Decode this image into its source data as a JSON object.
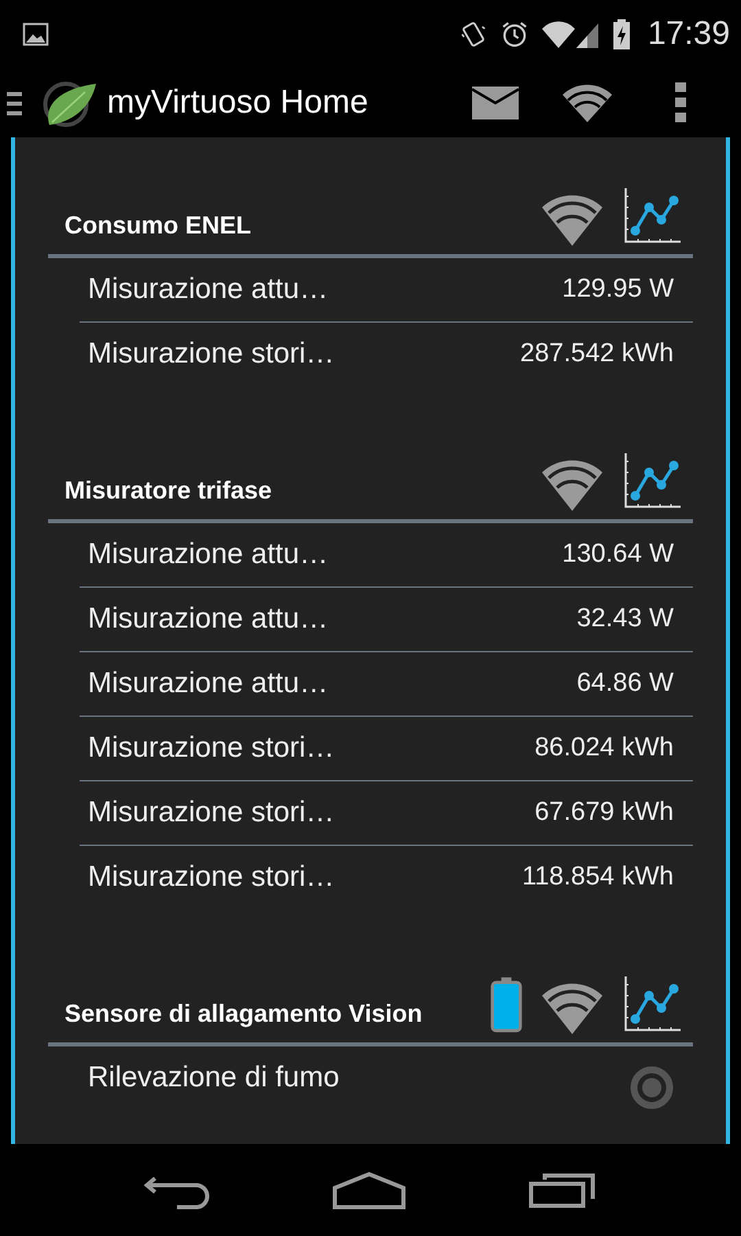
{
  "status_bar": {
    "time": "17:39"
  },
  "action_bar": {
    "title": "myVirtuoso Home"
  },
  "sections": [
    {
      "title": "Consumo ENEL",
      "icons": [
        {
          "kind": "wifi"
        },
        {
          "kind": "chart"
        }
      ],
      "rows": [
        {
          "kind": "value",
          "label": "Misurazione attu…",
          "value": "129.95 W"
        },
        {
          "kind": "value",
          "label": "Misurazione stori…",
          "value": "287.542 kWh"
        }
      ]
    },
    {
      "title": "Misuratore trifase",
      "icons": [
        {
          "kind": "wifi"
        },
        {
          "kind": "chart"
        }
      ],
      "rows": [
        {
          "kind": "value",
          "label": "Misurazione attu…",
          "value": "130.64 W"
        },
        {
          "kind": "value",
          "label": "Misurazione attu…",
          "value": "32.43 W"
        },
        {
          "kind": "value",
          "label": "Misurazione attu…",
          "value": "64.86 W"
        },
        {
          "kind": "value",
          "label": "Misurazione stori…",
          "value": "86.024 kWh"
        },
        {
          "kind": "value",
          "label": "Misurazione stori…",
          "value": "67.679 kWh"
        },
        {
          "kind": "value",
          "label": "Misurazione stori…",
          "value": "118.854 kWh"
        }
      ]
    },
    {
      "title": "Sensore di allagamento Vision",
      "icons": [
        {
          "kind": "battery"
        },
        {
          "kind": "wifi"
        },
        {
          "kind": "chart"
        }
      ],
      "rows": [
        {
          "kind": "indicator",
          "label": "Rilevazione di fumo"
        }
      ]
    }
  ]
}
